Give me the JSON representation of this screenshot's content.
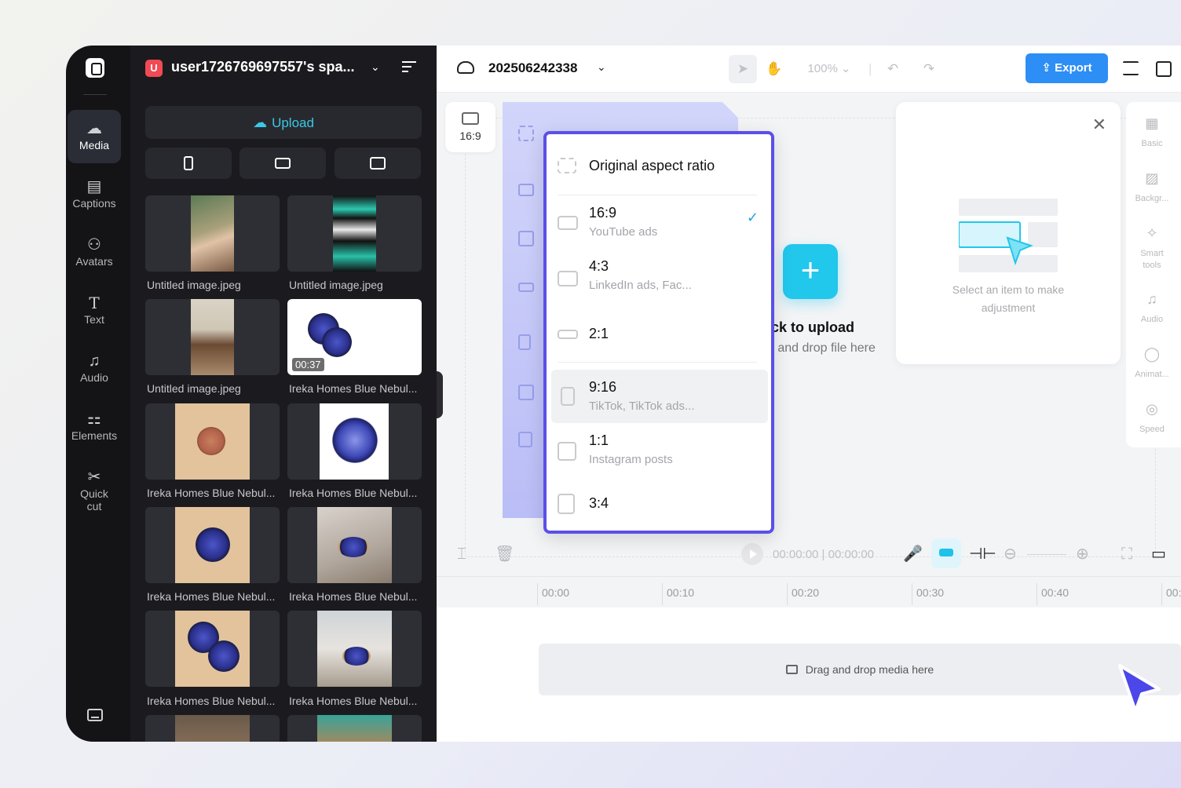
{
  "nav": {
    "items": [
      {
        "label": "Media",
        "icon": "cloud-upload-icon"
      },
      {
        "label": "Captions",
        "icon": "captions-icon"
      },
      {
        "label": "Avatars",
        "icon": "avatar-icon"
      },
      {
        "label": "Text",
        "icon": "text-icon"
      },
      {
        "label": "Audio",
        "icon": "music-note-icon"
      },
      {
        "label": "Elements",
        "icon": "elements-icon"
      },
      {
        "label": "Quick",
        "label2": "cut",
        "icon": "quick-cut-icon"
      }
    ]
  },
  "workspace": {
    "badge": "U",
    "name": "user1726769697557's spa...",
    "upload_label": "Upload"
  },
  "media": [
    {
      "label": "Untitled image.jpeg"
    },
    {
      "label": "Untitled image.jpeg"
    },
    {
      "label": "Untitled image.jpeg"
    },
    {
      "label": "Ireka Homes Blue Nebul...",
      "duration": "00:37"
    },
    {
      "label": "Ireka Homes Blue Nebul..."
    },
    {
      "label": "Ireka Homes Blue Nebul..."
    },
    {
      "label": "Ireka Homes Blue Nebul..."
    },
    {
      "label": "Ireka Homes Blue Nebul..."
    },
    {
      "label": "Ireka Homes Blue Nebul..."
    },
    {
      "label": "Ireka Homes Blue Nebul..."
    }
  ],
  "topbar": {
    "project_name": "202506242338",
    "zoom": "100%",
    "export_label": "Export"
  },
  "canvas": {
    "ratio_button": "16:9",
    "upload_title": "ick to upload",
    "upload_subtitle": "g and drop file here"
  },
  "aspect_dropdown": {
    "items": [
      {
        "title": "Original aspect ratio",
        "sub": ""
      },
      {
        "title": "16:9",
        "sub": "YouTube ads",
        "checked": true
      },
      {
        "title": "4:3",
        "sub": "LinkedIn ads, Fac..."
      },
      {
        "title": "2:1",
        "sub": ""
      },
      {
        "title": "9:16",
        "sub": "TikTok, TikTok ads...",
        "highlighted": true
      },
      {
        "title": "1:1",
        "sub": "Instagram posts"
      },
      {
        "title": "3:4",
        "sub": ""
      }
    ]
  },
  "properties": {
    "hint_line1": "Select an item to make",
    "hint_line2": "adjustment"
  },
  "rail": {
    "items": [
      {
        "label": "Basic"
      },
      {
        "label": "Backgr..."
      },
      {
        "label": "Smart",
        "label2": "tools"
      },
      {
        "label": "Audio"
      },
      {
        "label": "Animat..."
      },
      {
        "label": "Speed"
      }
    ]
  },
  "timeline": {
    "current_time": "00:00:00",
    "total_time": "00:00:00",
    "ticks": [
      "00:00",
      "00:10",
      "00:20",
      "00:30",
      "00:40",
      "00:"
    ],
    "drop_text": "Drag and drop media here"
  },
  "colors": {
    "accent": "#22c7ec",
    "export": "#2d8ef5",
    "highlight_border": "#5b4fe9",
    "cursor": "#4b47e8"
  }
}
